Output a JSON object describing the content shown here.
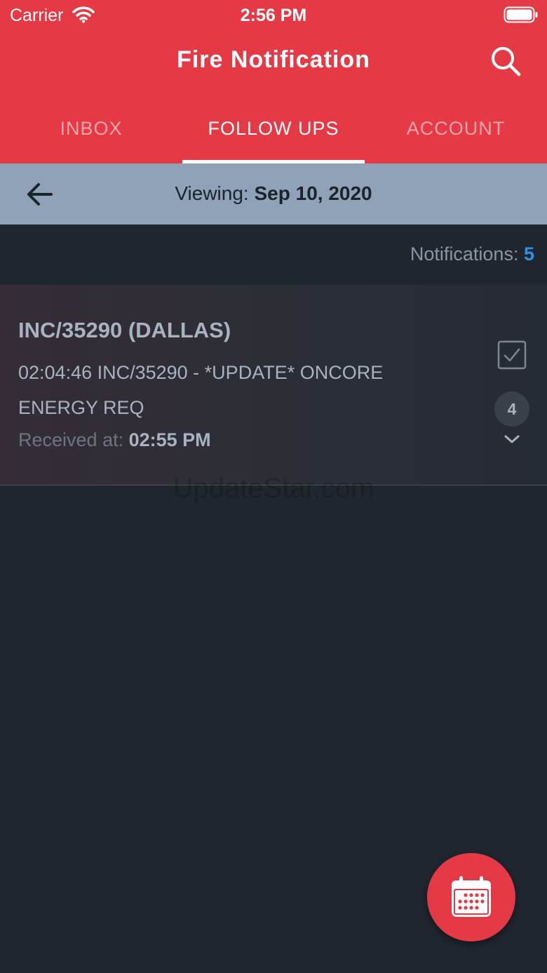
{
  "status_bar": {
    "carrier": "Carrier",
    "time": "2:56 PM"
  },
  "header": {
    "title": "Fire Notification"
  },
  "tabs": [
    {
      "label": "INBOX",
      "active": false
    },
    {
      "label": "FOLLOW UPS",
      "active": true
    },
    {
      "label": "ACCOUNT",
      "active": false
    }
  ],
  "date_bar": {
    "prefix": "Viewing:",
    "date": "Sep 10, 2020"
  },
  "notifications": {
    "label": "Notifications:",
    "count": "5"
  },
  "items": [
    {
      "title": "INC/35290 (DALLAS)",
      "body": "02:04:46 INC/35290 - *UPDATE* ONCORE ENERGY REQ",
      "received_label": "Received at:",
      "received_time": "02:55 PM",
      "badge": "4"
    }
  ],
  "watermark": "UpdateStar.com",
  "colors": {
    "brand": "#e63946",
    "date_bar": "#8fa2b8",
    "background": "#1f262e",
    "count": "#2f8fe3"
  },
  "icons": [
    "wifi-icon",
    "battery-icon",
    "search-icon",
    "back-arrow-icon",
    "checkbox-icon",
    "chevron-down-icon",
    "calendar-icon"
  ]
}
